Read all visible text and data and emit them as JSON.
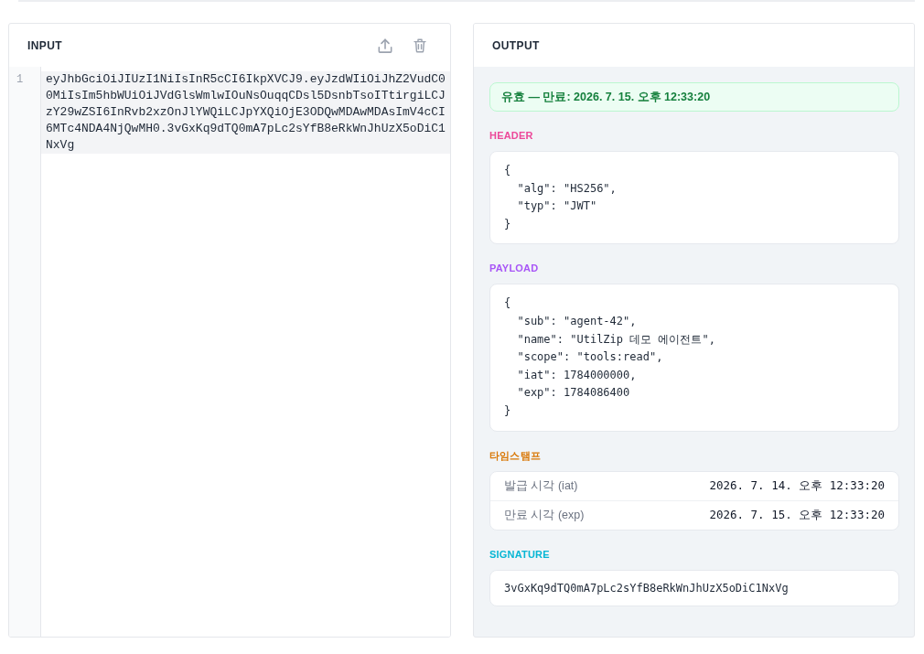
{
  "input_panel": {
    "title": "INPUT",
    "editor": {
      "line_numbers": [
        "1"
      ],
      "value": "eyJhbGciOiJIUzI1NiIsInR5cCI6IkpXVCJ9.eyJzdWIiOiJhZ2VudC00MiIsIm5hbWUiOiJVdGlsWmlwIOuNsOuqqCDsl5DsnbTsoITtirgiLCJzY29wZSI6InRvb2xzOnJlYWQiLCJpYXQiOjE3ODQwMDAwMDAsImV4cCI6MTc4NDA4NjQwMH0.3vGxKq9dTQ0mA7pLc2sYfB8eRkWnJhUzX5oDiC1NxVg"
    }
  },
  "output_panel": {
    "title": "OUTPUT",
    "status": {
      "kind": "valid",
      "text": "유효 — 만료: 2026. 7. 15. 오후 12:33:20"
    },
    "sections": [
      {
        "kind": "json",
        "title": "HEADER",
        "color": "#ec4899",
        "lines": [
          "{",
          "  \"alg\": \"HS256\",",
          "  \"typ\": \"JWT\"",
          "}"
        ]
      },
      {
        "kind": "json",
        "title": "PAYLOAD",
        "color": "#a855f7",
        "lines": [
          "{",
          "  \"sub\": \"agent-42\",",
          "  \"name\": \"UtilZip 데모 에이전트\",",
          "  \"scope\": \"tools:read\",",
          "  \"iat\": 1784000000,",
          "  \"exp\": 1784086400",
          "}"
        ]
      },
      {
        "kind": "table",
        "title": "타임스탬프",
        "color": "#d97706",
        "rows": [
          {
            "label": "발급 시각 (iat)",
            "value": "2026. 7. 14. 오후 12:33:20"
          },
          {
            "label": "만료 시각 (exp)",
            "value": "2026. 7. 15. 오후 12:33:20"
          }
        ]
      },
      {
        "kind": "text",
        "title": "SIGNATURE",
        "color": "#06b6d4",
        "text": "3vGxKq9dTQ0mA7pLc2sYfB8eRkWnJhUzX5oDiC1NxVg"
      }
    ]
  }
}
